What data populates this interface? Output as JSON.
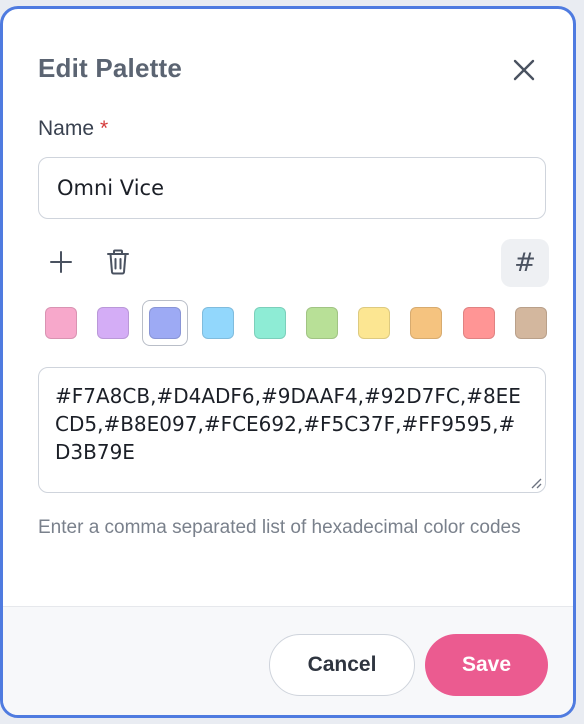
{
  "dialog": {
    "title": "Edit Palette"
  },
  "name_field": {
    "label": "Name",
    "required_marker": "*",
    "value": "Omni Vice"
  },
  "toolbar": {
    "add_icon": "plus-icon",
    "delete_icon": "trash-icon",
    "hex_toggle_label": "#"
  },
  "swatches": [
    {
      "color": "#F7A8CB"
    },
    {
      "color": "#D4ADF6"
    },
    {
      "color": "#9DAAF4",
      "selected": true
    },
    {
      "color": "#92D7FC"
    },
    {
      "color": "#8EECD5"
    },
    {
      "color": "#B8E097"
    },
    {
      "color": "#FCE692"
    },
    {
      "color": "#F5C37F"
    },
    {
      "color": "#FF9595"
    },
    {
      "color": "#D3B79E"
    }
  ],
  "codes_field": {
    "value": "#F7A8CB,#D4ADF6,#9DAAF4,#92D7FC,#8EECD5,#B8E097,#FCE692,#F5C37F,#FF9595,#D3B79E"
  },
  "help_text": "Enter a comma separated list of hexadecimal color codes",
  "footer": {
    "cancel_label": "Cancel",
    "save_label": "Save"
  },
  "colors": {
    "accent": "#EB5B90",
    "modal_border": "#4F7BE0"
  }
}
